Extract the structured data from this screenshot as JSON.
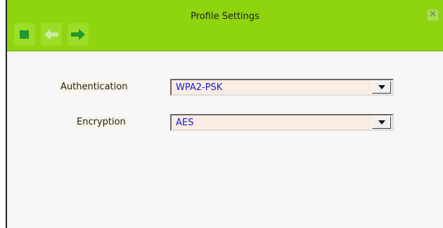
{
  "window": {
    "title": "Profile Settings",
    "close_glyph": "✕",
    "bar_color": "#8ed40f"
  },
  "toolbar": {
    "buttons": [
      {
        "icon": "stop-square-icon",
        "color": "#1f9a2e"
      },
      {
        "icon": "back-arrow-icon",
        "color": "#c8eba0"
      },
      {
        "icon": "forward-arrow-icon",
        "color": "#1f9a2e"
      }
    ]
  },
  "form": {
    "authentication": {
      "label": "Authentication",
      "value": "WPA2-PSK"
    },
    "encryption": {
      "label": "Encryption",
      "value": "AES"
    }
  }
}
